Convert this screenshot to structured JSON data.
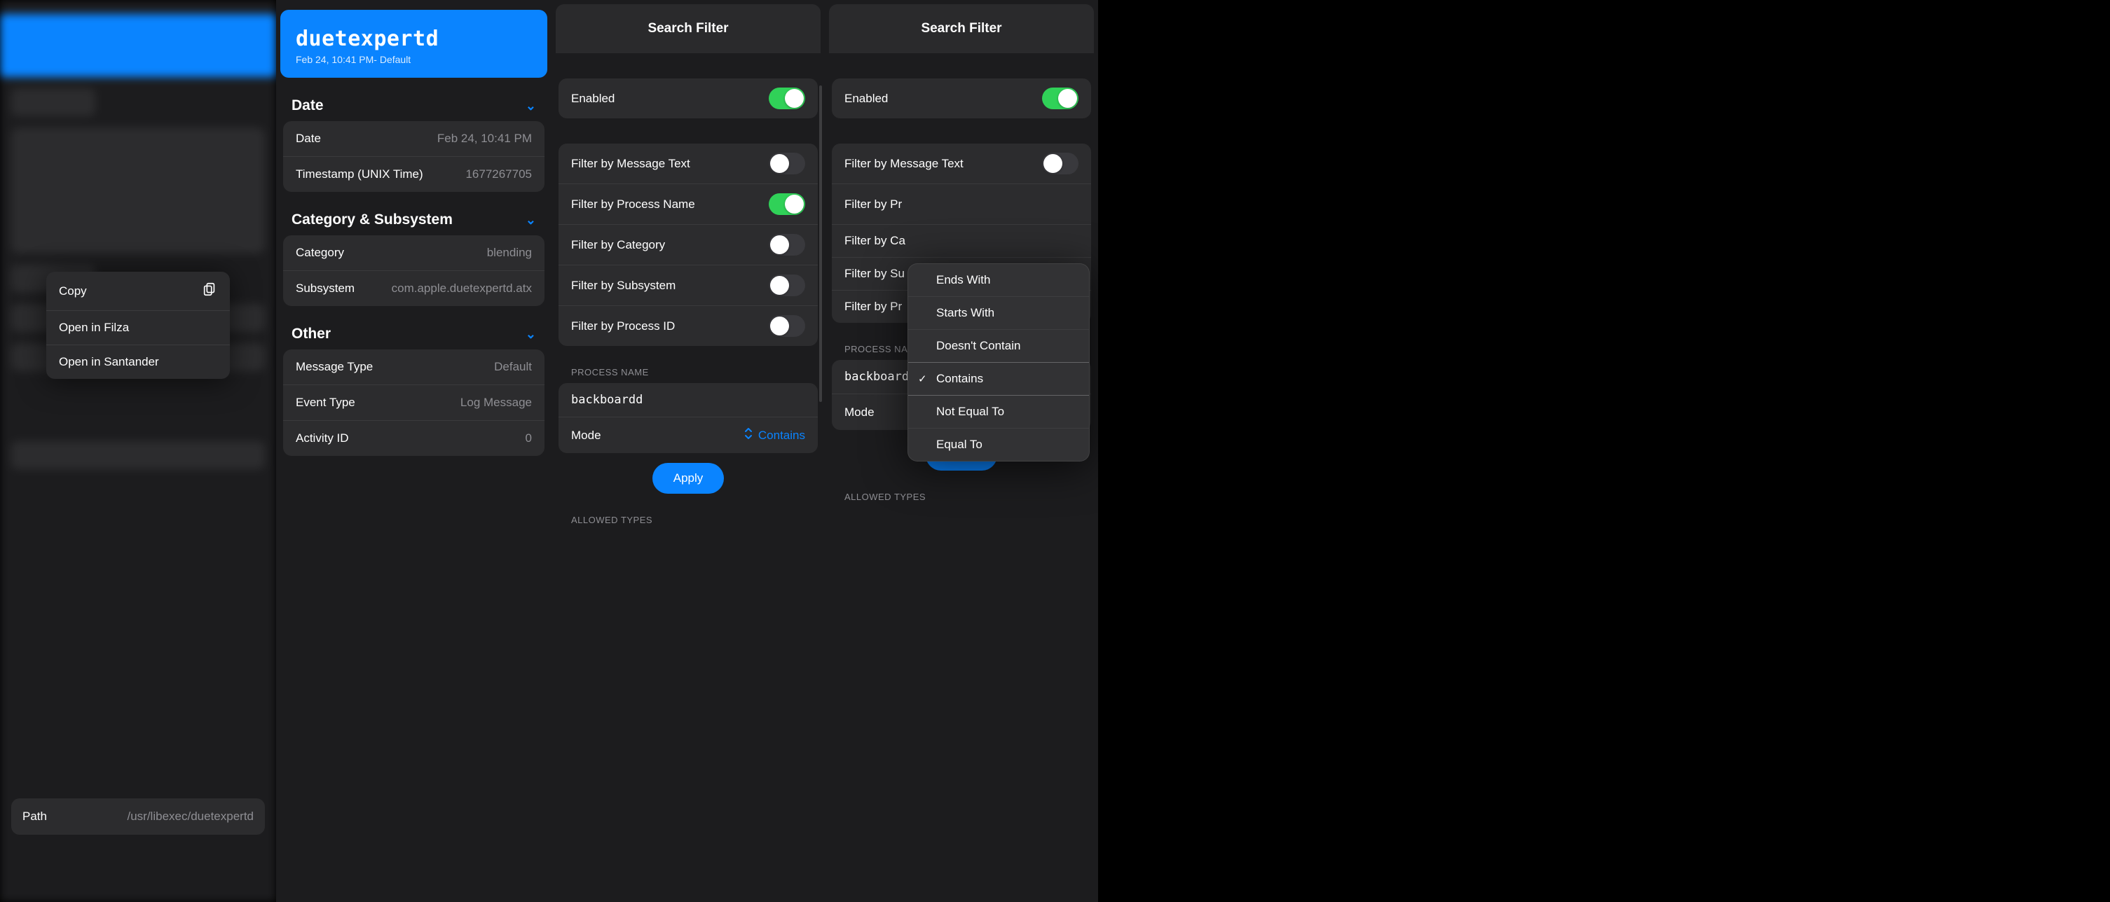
{
  "left_blurred": {
    "path_label": "Path",
    "path_value": "/usr/libexec/duetexpertd"
  },
  "context_menu": {
    "copy": "Copy",
    "open_filza": "Open in Filza",
    "open_santander": "Open in Santander"
  },
  "detail": {
    "title": "duetexpertd",
    "subtitle": "Feb 24, 10:41 PM- Default",
    "sections": {
      "date": {
        "label": "Date",
        "rows": {
          "date_k": "Date",
          "date_v": "Feb 24, 10:41 PM",
          "ts_k": "Timestamp (UNIX Time)",
          "ts_v": "1677267705"
        }
      },
      "catsub": {
        "label": "Category & Subsystem",
        "rows": {
          "cat_k": "Category",
          "cat_v": "blending",
          "sub_k": "Subsystem",
          "sub_v": "com.apple.duetexpertd.atx"
        }
      },
      "other": {
        "label": "Other",
        "rows": {
          "mt_k": "Message Type",
          "mt_v": "Default",
          "et_k": "Event Type",
          "et_v": "Log Message",
          "aid_k": "Activity ID",
          "aid_v": "0"
        }
      }
    }
  },
  "search_filter": {
    "title": "Search Filter",
    "enabled_label": "Enabled",
    "filters": {
      "msg": "Filter by Message Text",
      "proc": "Filter by Process Name",
      "cat": "Filter by Category",
      "sub": "Filter by Subsystem",
      "pid": "Filter by Process ID"
    },
    "process_name_label": "PROCESS NAME",
    "process_name_value": "backboardd",
    "mode_label": "Mode",
    "mode_value": "Contains",
    "apply": "Apply",
    "allowed_types": "ALLOWED TYPES"
  },
  "search_filter_right": {
    "filters_trunc": {
      "proc": "Filter by Pr",
      "cat": "Filter by Ca",
      "sub": "Filter by Su",
      "pid": "Filter by Pr"
    },
    "process_name_label_trunc": "PROCESS NA",
    "process_name_value_trunc": "backboard"
  },
  "mode_menu": {
    "ends": "Ends With",
    "starts": "Starts With",
    "not_contain": "Doesn't Contain",
    "contains": "Contains",
    "neq": "Not Equal To",
    "eq": "Equal To"
  }
}
